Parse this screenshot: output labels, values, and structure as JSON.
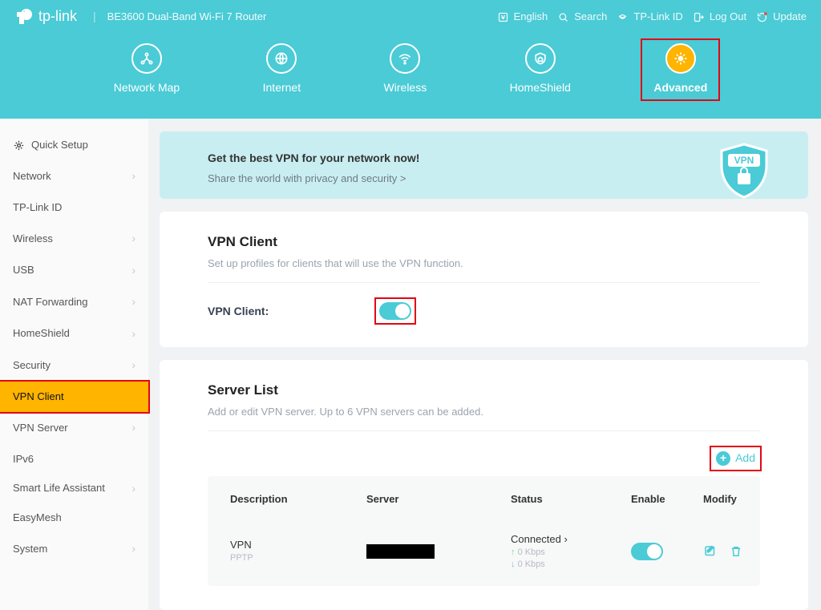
{
  "header": {
    "brand": "tp-link",
    "model": "BE3600 Dual-Band Wi-Fi 7 Router",
    "tools": {
      "lang": "English",
      "search": "Search",
      "id": "TP-Link ID",
      "logout": "Log Out",
      "update": "Update"
    },
    "nav": {
      "map": "Network Map",
      "internet": "Internet",
      "wireless": "Wireless",
      "homeshield": "HomeShield",
      "advanced": "Advanced"
    }
  },
  "sidebar": {
    "quick": "Quick Setup",
    "items": [
      {
        "label": "Network",
        "chev": true
      },
      {
        "label": "TP-Link ID",
        "chev": false
      },
      {
        "label": "Wireless",
        "chev": true
      },
      {
        "label": "USB",
        "chev": true
      },
      {
        "label": "NAT Forwarding",
        "chev": true
      },
      {
        "label": "HomeShield",
        "chev": true
      },
      {
        "label": "Security",
        "chev": true
      },
      {
        "label": "VPN Client",
        "chev": false,
        "selected": true
      },
      {
        "label": "VPN Server",
        "chev": true
      },
      {
        "label": "IPv6",
        "chev": false
      },
      {
        "label": "Smart Life Assistant",
        "chev": true
      },
      {
        "label": "EasyMesh",
        "chev": false
      },
      {
        "label": "System",
        "chev": true
      }
    ]
  },
  "banner": {
    "title": "Get the best VPN for your network now!",
    "text": "Share the world with privacy and security >",
    "badge": "VPN"
  },
  "vpn": {
    "title": "VPN Client",
    "sub": "Set up profiles for clients that will use the VPN function.",
    "toggle_label": "VPN Client:"
  },
  "server": {
    "title": "Server List",
    "sub": "Add or edit VPN server. Up to 6 VPN servers can be added.",
    "add": "Add",
    "cols": {
      "desc": "Description",
      "server": "Server",
      "status": "Status",
      "enable": "Enable",
      "modify": "Modify"
    },
    "rows": [
      {
        "desc": "VPN",
        "proto": "PPTP",
        "status": "Connected ›",
        "up": "0 Kbps",
        "down": "0 Kbps"
      }
    ]
  }
}
